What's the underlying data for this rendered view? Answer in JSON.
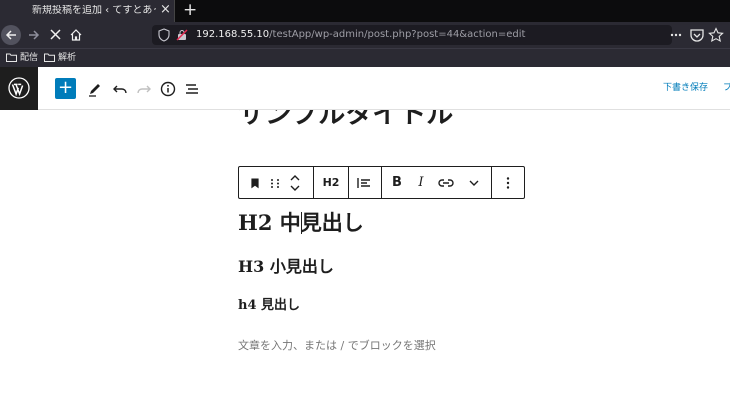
{
  "browser": {
    "tab_title": "新規投稿を追加 ‹ てすとあっぷ — Wo",
    "tab_close": "×",
    "new_tab": "+",
    "url_host": "192.168.55.10",
    "url_path": "/testApp/wp-admin/post.php?post=44&action=edit",
    "bookmarks": [
      "配信",
      "解析"
    ]
  },
  "wp_header": {
    "add_label": "+",
    "save_draft": "下書き保存",
    "preview": "プ"
  },
  "post": {
    "title": "サンプルタイトル",
    "h2_before": "H2 中",
    "h2_after": "見出し",
    "h3": "H3 小見出し",
    "h4": "h4 見出し",
    "placeholder": "文章を入力、または / でブロックを選択"
  },
  "block_toolbar": {
    "heading_level": "H2",
    "bold": "B",
    "italic": "I"
  }
}
